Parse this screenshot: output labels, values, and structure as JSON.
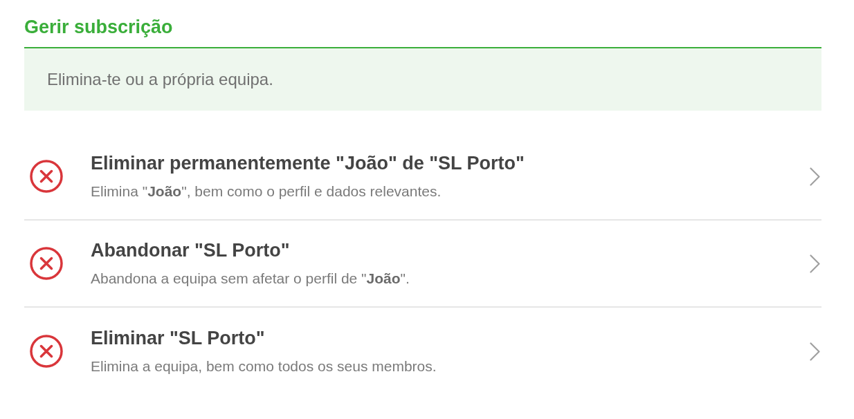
{
  "section": {
    "title": "Gerir subscrição",
    "description": "Elimina-te ou a própria equipa."
  },
  "options": [
    {
      "title": "Eliminar permanentemente \"João\" de \"SL Porto\"",
      "subtitle": "Elimina \"**João**\", bem como o perfil e dados relevantes."
    },
    {
      "title": "Abandonar \"SL Porto\"",
      "subtitle": "Abandona a equipa sem afetar o perfil de \"**João**\"."
    },
    {
      "title": "Eliminar \"SL Porto\"",
      "subtitle": "Elimina a equipa, bem como todos os seus membros."
    }
  ]
}
